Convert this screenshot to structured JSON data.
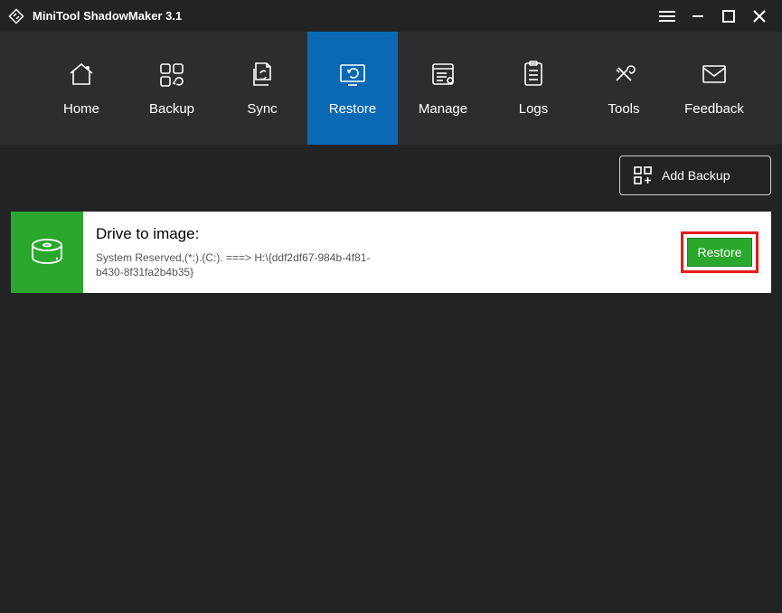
{
  "title": "MiniTool ShadowMaker 3.1",
  "nav": {
    "home": "Home",
    "backup": "Backup",
    "sync": "Sync",
    "restore": "Restore",
    "manage": "Manage",
    "logs": "Logs",
    "tools": "Tools",
    "feedback": "Feedback"
  },
  "actions": {
    "add_backup": "Add Backup"
  },
  "card": {
    "heading": "Drive to image:",
    "details": "System Reserved,(*:).(C:). ===> H:\\{ddf2df67-984b-4f81-b430-8f31fa2b4b35}",
    "restore": "Restore"
  }
}
